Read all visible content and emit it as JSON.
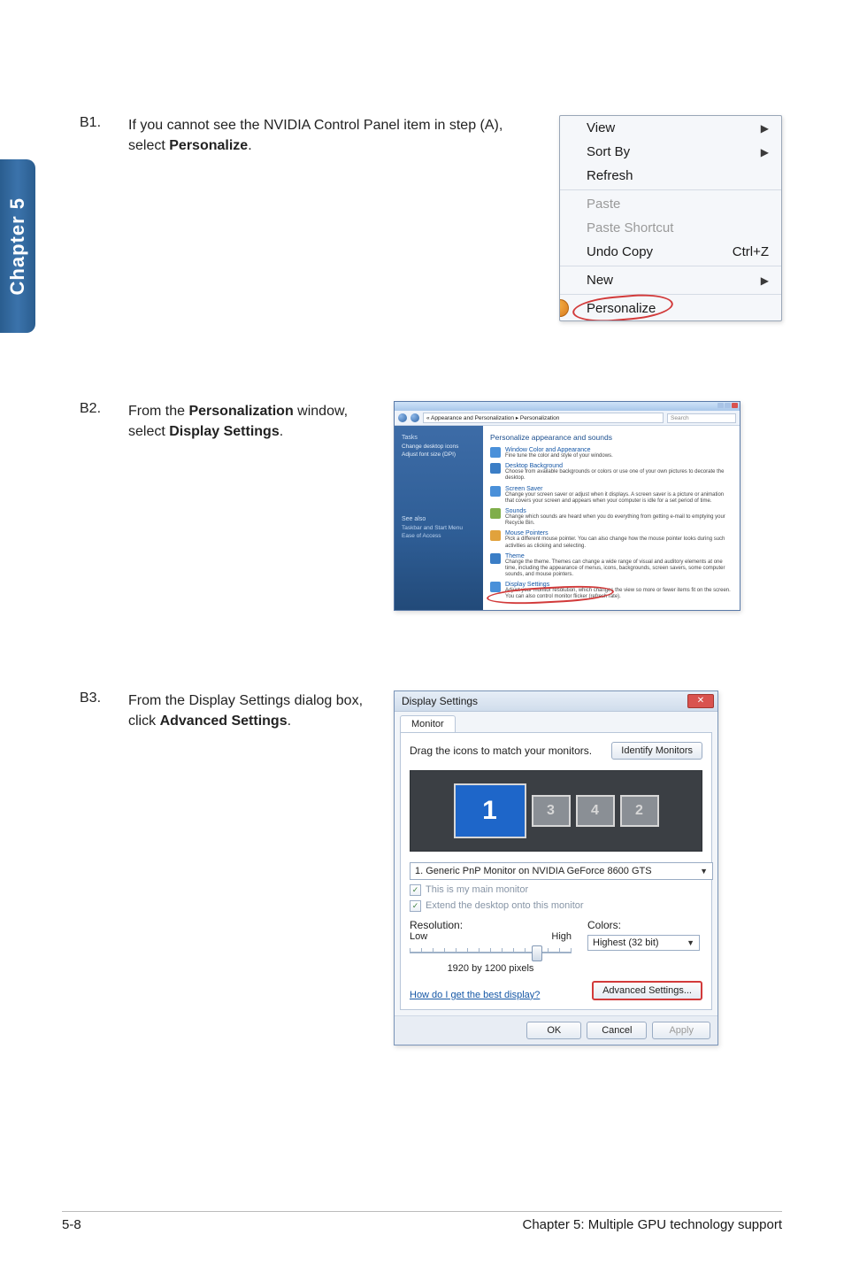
{
  "sidebar_tab": "Chapter 5",
  "steps": {
    "b1": {
      "num": "B1.",
      "text_a": "If you cannot see the NVIDIA Control Panel item in step (A), select ",
      "bold": "Personalize",
      "text_b": "."
    },
    "b2": {
      "num": "B2.",
      "text_a": "From the ",
      "bold_a": "Personalization",
      "text_b": " window, select ",
      "bold_b": "Display Settings",
      "text_c": "."
    },
    "b3": {
      "num": "B3.",
      "text_a": "From the Display Settings dialog box, click ",
      "bold": "Advanced Settings",
      "text_b": "."
    }
  },
  "context_menu": {
    "view": "View",
    "sortby": "Sort By",
    "refresh": "Refresh",
    "paste": "Paste",
    "paste_shortcut": "Paste Shortcut",
    "undo_copy": "Undo Copy",
    "undo_copy_key": "Ctrl+Z",
    "new": "New",
    "personalize": "Personalize"
  },
  "personalization": {
    "breadcrumb": "« Appearance and Personalization ▸ Personalization",
    "search_placeholder": "Search",
    "tasks_header": "Tasks",
    "task1": "Change desktop icons",
    "task2": "Adjust font size (DPI)",
    "see_also": "See also",
    "see1": "Taskbar and Start Menu",
    "see2": "Ease of Access",
    "heading": "Personalize appearance and sounds",
    "items": [
      {
        "t": "Window Color and Appearance",
        "d": "Fine tune the color and style of your windows."
      },
      {
        "t": "Desktop Background",
        "d": "Choose from available backgrounds or colors or use one of your own pictures to decorate the desktop."
      },
      {
        "t": "Screen Saver",
        "d": "Change your screen saver or adjust when it displays. A screen saver is a picture or animation that covers your screen and appears when your computer is idle for a set period of time."
      },
      {
        "t": "Sounds",
        "d": "Change which sounds are heard when you do everything from getting e-mail to emptying your Recycle Bin."
      },
      {
        "t": "Mouse Pointers",
        "d": "Pick a different mouse pointer. You can also change how the mouse pointer looks during such activities as clicking and selecting."
      },
      {
        "t": "Theme",
        "d": "Change the theme. Themes can change a wide range of visual and auditory elements at one time, including the appearance of menus, icons, backgrounds, screen savers, some computer sounds, and mouse pointers."
      },
      {
        "t": "Display Settings",
        "d": "Adjust your monitor resolution, which changes the view so more or fewer items fit on the screen. You can also control monitor flicker (refresh rate)."
      }
    ]
  },
  "display_settings": {
    "title": "Display Settings",
    "tab": "Monitor",
    "drag_text": "Drag the icons to match your monitors.",
    "identify": "Identify Monitors",
    "mon_numbers": [
      "1",
      "3",
      "4",
      "2"
    ],
    "monitor_select": "1. Generic PnP Monitor on NVIDIA GeForce 8600 GTS",
    "chk_main": "This is my main monitor",
    "chk_extend": "Extend the desktop onto this monitor",
    "res_label": "Resolution:",
    "colors_label": "Colors:",
    "low": "Low",
    "high": "High",
    "res_current": "1920 by 1200 pixels",
    "colors_value": "Highest (32 bit)",
    "help_link": "How do I get the best display?",
    "adv": "Advanced Settings...",
    "ok": "OK",
    "cancel": "Cancel",
    "apply": "Apply"
  },
  "footer": {
    "left": "5-8",
    "right": "Chapter 5: Multiple GPU technology support"
  }
}
